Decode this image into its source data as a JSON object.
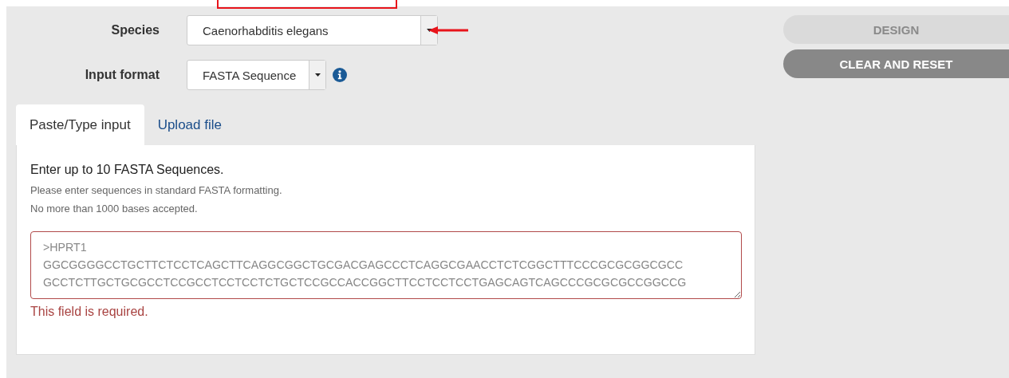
{
  "form": {
    "species": {
      "label": "Species",
      "value": "Caenorhabditis elegans"
    },
    "input_format": {
      "label": "Input format",
      "value": "FASTA Sequence"
    }
  },
  "tabs": [
    {
      "label": "Paste/Type input",
      "selected": true
    },
    {
      "label": "Upload file",
      "selected": false
    }
  ],
  "panel": {
    "heading": "Enter up to 10 FASTA Sequences.",
    "hints": [
      "Please enter sequences in standard FASTA formatting.",
      "No more than 1000 bases accepted."
    ],
    "sequence": {
      "placeholder": ">HPRT1\nGGCGGGGCCTGCTTCTCCTCAGCTTCAGGCGGCTGCGACGAGCCCTCAGGCGAACCTCTCGGCTTTCCCGCGCGGCGCC\nGCCTCTTGCTGCGCCTCCGCCTCCTCCTCTGCTCCGCCACCGGCTTCCTCCTCCTGAGCAGTCAGCCCGCGCGCCGGCCG",
      "invalid": true
    },
    "error": "This field is required."
  },
  "buttons": [
    {
      "label": "DESIGN",
      "disabled": true
    },
    {
      "label": "CLEAR AND RESET",
      "disabled": false
    }
  ]
}
